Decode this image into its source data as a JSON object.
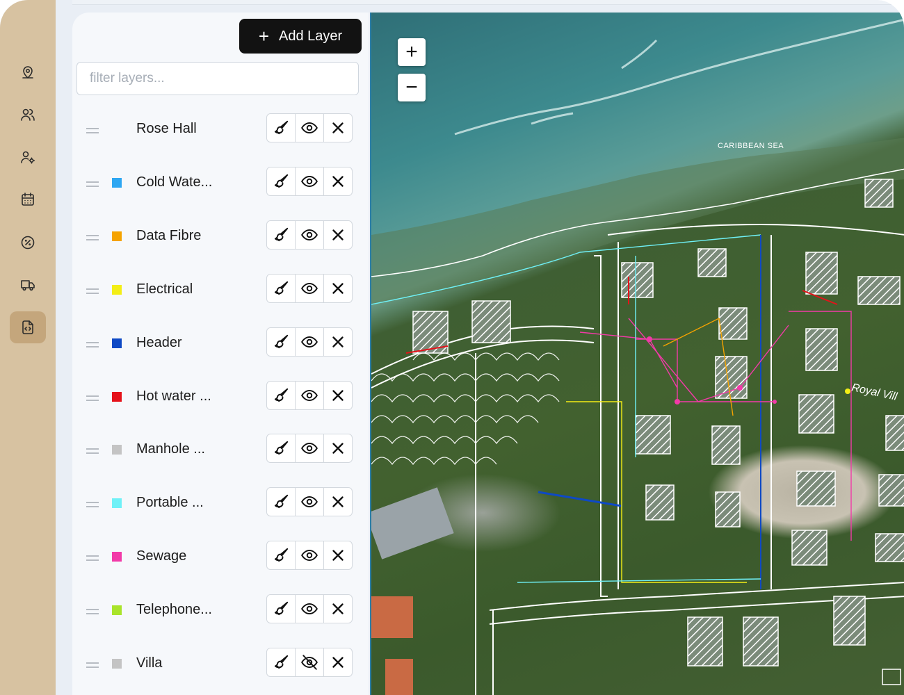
{
  "toolbar": {
    "add_layer_label": "Add Layer"
  },
  "filter": {
    "placeholder": "filter layers...",
    "value": ""
  },
  "nav": [
    {
      "name": "nav-map-pin",
      "icon": "map-pin-icon"
    },
    {
      "name": "nav-users",
      "icon": "users-icon"
    },
    {
      "name": "nav-user-settings",
      "icon": "user-settings-icon"
    },
    {
      "name": "nav-calendar",
      "icon": "calendar-icon"
    },
    {
      "name": "nav-discount",
      "icon": "discount-icon"
    },
    {
      "name": "nav-delivery",
      "icon": "truck-icon"
    },
    {
      "name": "nav-code-file",
      "icon": "code-file-icon",
      "active": true
    }
  ],
  "layers": [
    {
      "name": "Rose Hall",
      "color": "",
      "visible": true
    },
    {
      "name": "Cold Wate...",
      "color": "#2ea7f2",
      "visible": true
    },
    {
      "name": "Data Fibre",
      "color": "#f5a300",
      "visible": true
    },
    {
      "name": "Electrical",
      "color": "#f3ee16",
      "visible": true
    },
    {
      "name": "Header",
      "color": "#0e49c5",
      "visible": true
    },
    {
      "name": "Hot water ...",
      "color": "#e5121a",
      "visible": true
    },
    {
      "name": "Manhole ...",
      "color": "#c4c4c4",
      "visible": true
    },
    {
      "name": "Portable ...",
      "color": "#6ff1f7",
      "visible": true
    },
    {
      "name": "Sewage",
      "color": "#f23aa8",
      "visible": true
    },
    {
      "name": "Telephone...",
      "color": "#a9e42a",
      "visible": true
    },
    {
      "name": "Villa",
      "color": "#c4c4c4",
      "visible": false
    }
  ],
  "map": {
    "zoom_in_label": "+",
    "zoom_out_label": "−",
    "labels": {
      "sea": "CARIBBEAN SEA",
      "villa": "Royal Vill"
    }
  }
}
